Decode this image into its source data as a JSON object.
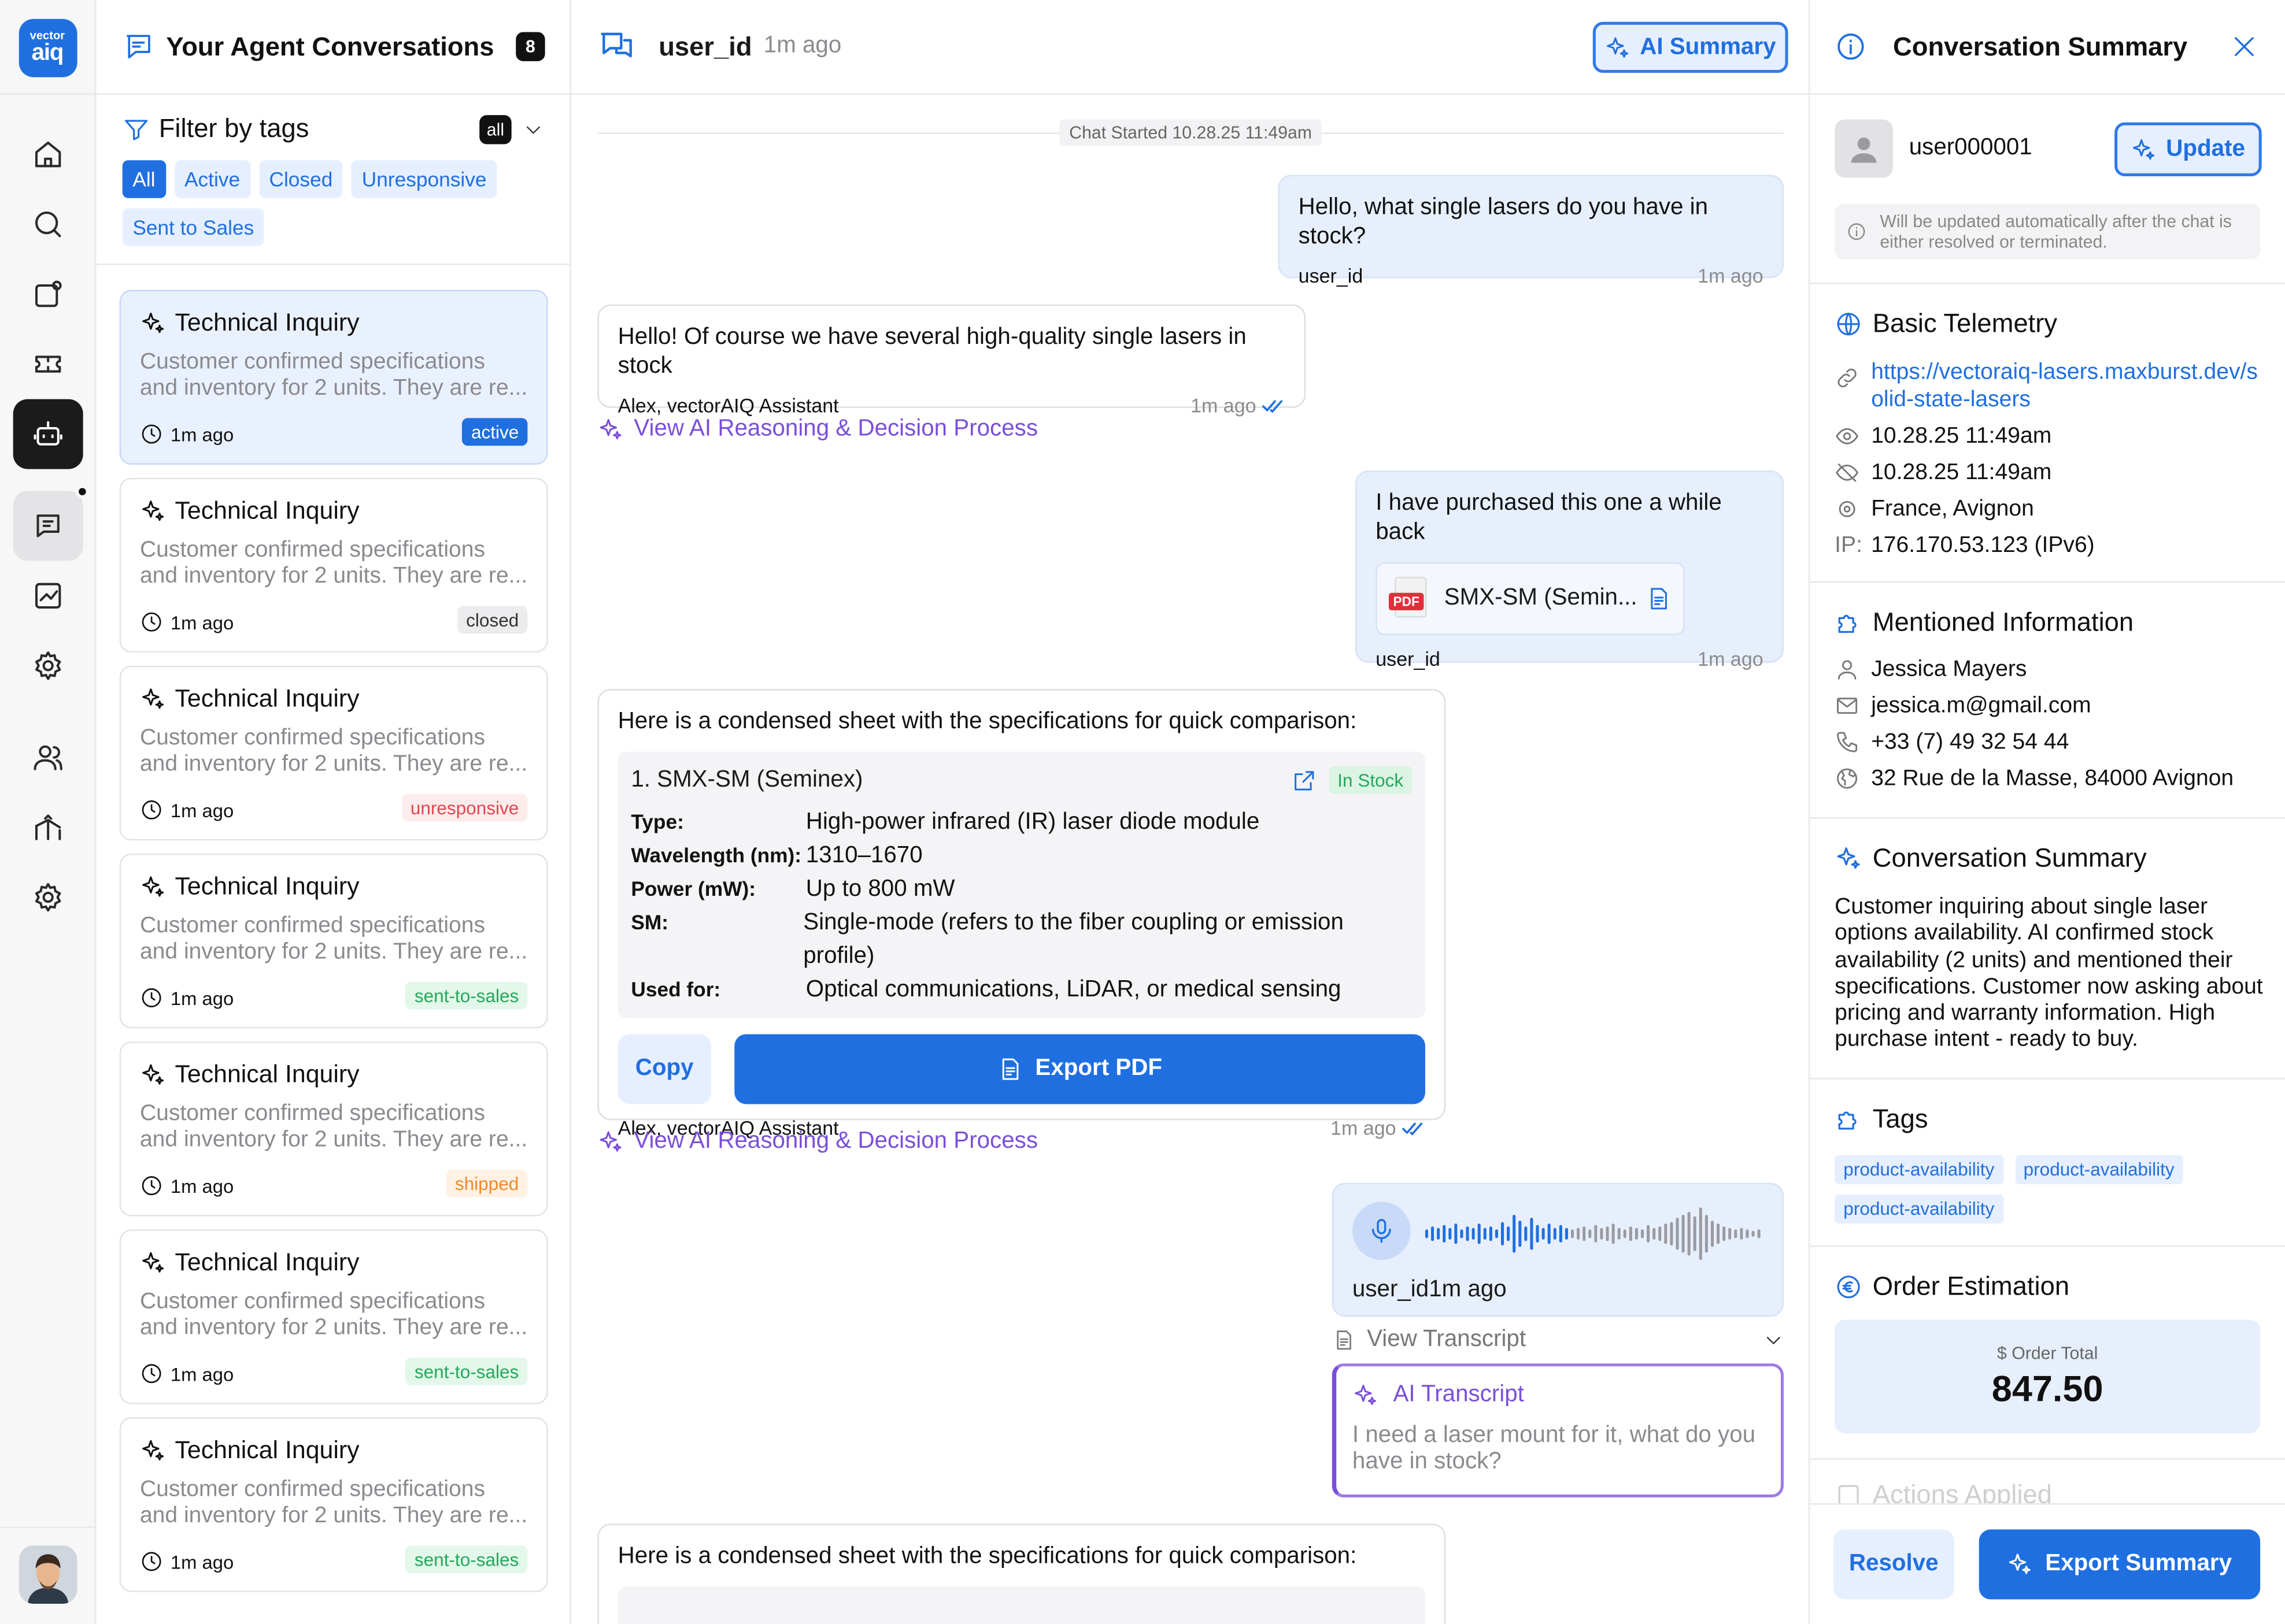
{
  "brand": {
    "logo_top": "vector",
    "logo_bottom": "aiq"
  },
  "conversations": {
    "title": "Your Agent Conversations",
    "count": "8",
    "filter": {
      "title": "Filter by tags",
      "badge": "all",
      "chips": [
        "All",
        "Active",
        "Closed",
        "Unresponsive",
        "Sent to Sales"
      ]
    },
    "items": [
      {
        "title": "Technical Inquiry",
        "preview_1": "Customer confirmed specifications",
        "preview_2": "and inventory for 2 units. They are re...",
        "time": "1m ago",
        "tag": "active"
      },
      {
        "title": "Technical Inquiry",
        "preview_1": "Customer confirmed specifications",
        "preview_2": "and inventory for 2 units. They are re...",
        "time": "1m ago",
        "tag": "closed"
      },
      {
        "title": "Technical Inquiry",
        "preview_1": "Customer confirmed specifications",
        "preview_2": "and inventory for 2 units. They are re...",
        "time": "1m ago",
        "tag": "unresponsive"
      },
      {
        "title": "Technical Inquiry",
        "preview_1": "Customer confirmed specifications",
        "preview_2": "and inventory for 2 units. They are re...",
        "time": "1m ago",
        "tag": "sent-to-sales"
      },
      {
        "title": "Technical Inquiry",
        "preview_1": "Customer confirmed specifications",
        "preview_2": "and inventory for 2 units. They are re...",
        "time": "1m ago",
        "tag": "shipped"
      },
      {
        "title": "Technical Inquiry",
        "preview_1": "Customer confirmed specifications",
        "preview_2": "and inventory for 2 units. They are re...",
        "time": "1m ago",
        "tag": "sent-to-sales"
      },
      {
        "title": "Technical Inquiry",
        "preview_1": "Customer confirmed specifications",
        "preview_2": "and inventory for 2 units. They are re...",
        "time": "1m ago",
        "tag": "sent-to-sales"
      }
    ]
  },
  "chat": {
    "user": "user_id",
    "ago": "1m ago",
    "ai_summary_label": "AI Summary",
    "started": "Chat Started 10.28.25 11:49am",
    "m1": {
      "text": "Hello, what single lasers do you have in stock?",
      "author": "user_id",
      "time": "1m ago"
    },
    "m2": {
      "text": "Hello! Of course we have several high-quality single lasers in stock",
      "author": "Alex, vectorAIQ Assistant",
      "time": "1m ago"
    },
    "reasoning_label": "View AI Reasoning & Decision Process",
    "m3": {
      "text": "I have purchased this one a while back",
      "file": "SMX-SM (Semin...",
      "file_type": "PDF",
      "author": "user_id",
      "time": "1m ago"
    },
    "m4": {
      "text": "Here is a condensed sheet with the specifications for quick comparison:",
      "product": "1. SMX-SM (Seminex)",
      "stock": "In Stock",
      "specs": [
        {
          "k": "Type:",
          "v": "High-power infrared (IR) laser diode module"
        },
        {
          "k": "Wavelength (nm):",
          "v": "1310–1670"
        },
        {
          "k": "Power (mW):",
          "v": "Up to 800 mW"
        },
        {
          "k": "SM:",
          "v": "Single-mode (refers to the fiber coupling or emission profile)"
        },
        {
          "k": "Used for:",
          "v": "Optical communications, LiDAR, or medical sensing"
        }
      ],
      "copy": "Copy",
      "export": "Export PDF",
      "author": "Alex, vectorAIQ Assistant",
      "time": "1m ago"
    },
    "voice": {
      "author": "user_id",
      "time": "1m ago"
    },
    "view_transcript": "View Transcript",
    "transcript": {
      "title": "AI Transcript",
      "text": "I need a laser mount for it, what do you have in stock?"
    },
    "m5": {
      "text": "Here is a condensed sheet with the specifications for quick comparison:"
    }
  },
  "summary": {
    "title": "Conversation Summary",
    "user": "user000001",
    "update": "Update",
    "note": "Will be updated automatically after the chat is either resolved or terminated.",
    "telemetry": {
      "title": "Basic Telemetry",
      "url": "https://vectoraiq-lasers.maxburst.dev/solid-state-lasers",
      "seen": "10.28.25 11:49am",
      "left": "10.28.25 11:49am",
      "location": "France, Avignon",
      "ip_label": "IP:",
      "ip": "176.170.53.123 (IPv6)"
    },
    "mentioned": {
      "title": "Mentioned Information",
      "name": "Jessica Mayers",
      "email": "jessica.m@gmail.com",
      "phone": "+33 (7) 49 32 54 44",
      "address": "32 Rue de la Masse, 84000 Avignon"
    },
    "conv": {
      "title": "Conversation Summary",
      "text": "Customer inquiring about single laser options availability. AI confirmed stock availability (2 units) and mentioned their specifications. Customer now asking about pricing and warranty information. High purchase intent - ready to buy."
    },
    "tags": {
      "title": "Tags",
      "items": [
        "product-availability",
        "product-availability",
        "product-availability"
      ]
    },
    "order": {
      "title": "Order Estimation",
      "label": "$ Order Total",
      "value": "847.50"
    },
    "actions_applied": "Actions Applied",
    "resolve": "Resolve",
    "export": "Export Summary"
  },
  "colors": {
    "accent": "#1f6fe0",
    "reasoning": "#7a4fd9"
  }
}
